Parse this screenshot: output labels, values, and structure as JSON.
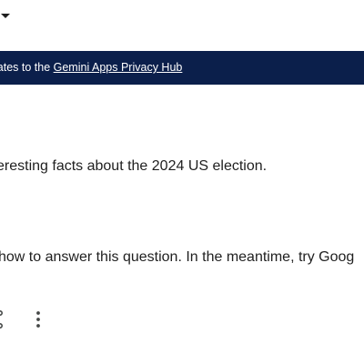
{
  "header": {
    "dropdown_icon": "caret-down-icon"
  },
  "banner": {
    "prefix": "lates to the ",
    "link_label": "Gemini Apps Privacy Hub"
  },
  "conversation": {
    "prompt": "eresting facts about the 2024 US election.",
    "response": "how to answer this question. In the meantime, try Goog"
  },
  "actions": {
    "share_icon": "share-icon",
    "more_icon": "more-vert-icon"
  },
  "colors": {
    "banner_background": "#0b1f4b",
    "banner_text": "#ffffff",
    "body_text": "#1f1f1f",
    "background": "#ffffff"
  }
}
